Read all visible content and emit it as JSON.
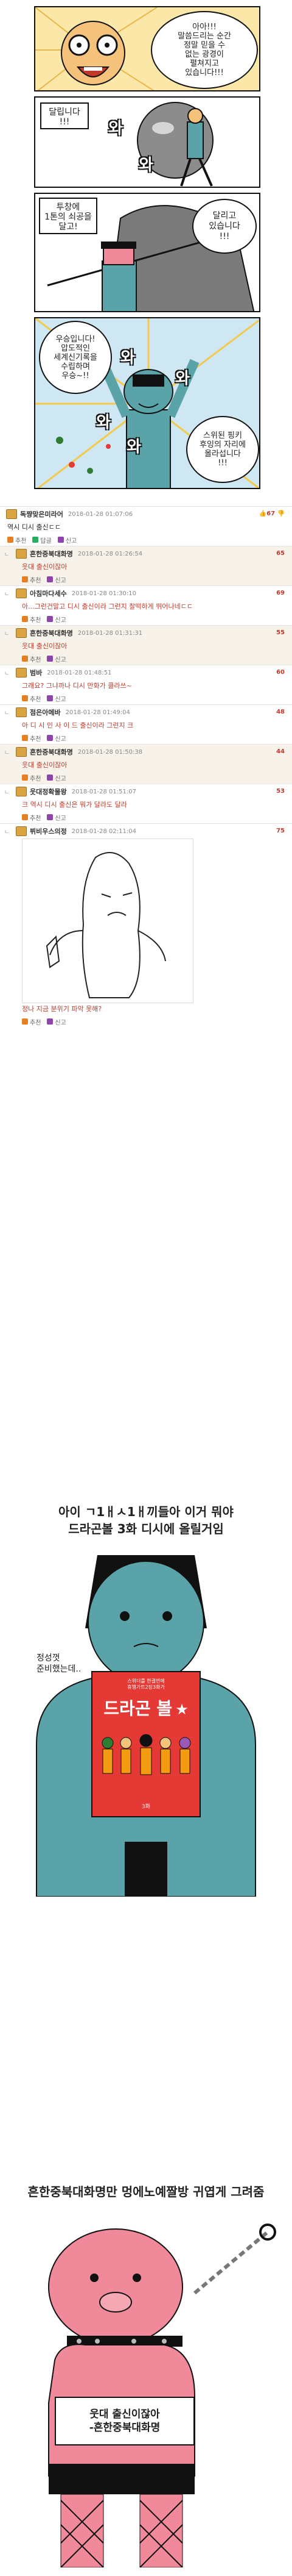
{
  "panels": {
    "p1": {
      "speech": "아아!!!\n말씀드리는 순간\n정말 믿을 수\n없는 광경이\n펼쳐지고\n있습니다!!!"
    },
    "p2": {
      "speech": "달립니다\n!!!",
      "wa_left": "와",
      "wa_right": "와"
    },
    "p3": {
      "caption_left": "투창에\n1톤의 쇠공을\n달고!",
      "caption_right": "달리고\n있습니다\n!!!"
    },
    "p4": {
      "speech_left": "우승입니다!\n압도적인\n세계신기록을\n수립하며\n우승~!!",
      "speech_right": "스위된 핑키\n후잉의 자리에\n올라섭니다\n!!!",
      "wa1": "와",
      "wa2": "와",
      "wa3": "와",
      "wa4": "와"
    }
  },
  "comments": [
    {
      "reply": false,
      "nick": "독쨩맞은미라어",
      "date": "2018-01-28 01:07:06",
      "likes": "67",
      "text": "역시 디시 출신ㄷㄷ",
      "actions": [
        "추천",
        "답글",
        "신고"
      ]
    },
    {
      "reply": true,
      "nick": "흔한중북대화명",
      "date": "2018-01-28 01:26:54",
      "likes": "65",
      "text": "웃대 출신이잖아",
      "actions": [
        "추천",
        "신고"
      ]
    },
    {
      "reply": true,
      "nick": "아침마다세수",
      "date": "2018-01-28 01:30:10",
      "likes": "69",
      "text": "아...그런건말고 디시 출신이라 그런지 찰떡하게 뛰어나네ㄷㄷ",
      "actions": [
        "추천",
        "신고"
      ]
    },
    {
      "reply": true,
      "nick": "흔한중북대화명",
      "date": "2018-01-28 01:31:31",
      "likes": "55",
      "text": "웃대 출신이잖아",
      "actions": [
        "추천",
        "신고"
      ]
    },
    {
      "reply": true,
      "nick": "범바",
      "date": "2018-01-28 01:48:51",
      "likes": "60",
      "text": "그래요? 그냐까나 디시 만화가 클라쓰~",
      "actions": [
        "추천",
        "신고"
      ]
    },
    {
      "reply": true,
      "nick": "점은아메바",
      "date": "2018-01-28 01:49:04",
      "likes": "48",
      "text": "아 디 시 인 사 이 드 출신이라 그런지 크",
      "actions": [
        "추천",
        "신고"
      ]
    },
    {
      "reply": true,
      "nick": "흔한중북대화명",
      "date": "2018-01-28 01:50:38",
      "likes": "44",
      "text": "웃대 출신이잖아",
      "actions": [
        "추천",
        "신고"
      ]
    },
    {
      "reply": true,
      "nick": "웃대정확물왕",
      "date": "2018-01-28 01:51:07",
      "likes": "53",
      "text": "크 역시 디시 출신은 뭐가 달라도 달라",
      "actions": [
        "추천",
        "신고"
      ]
    },
    {
      "reply": true,
      "nick": "뷔비우스의정",
      "date": "2018-01-28 02:11:04",
      "likes": "75",
      "text": "정나 지금 분위기 파악 못해?",
      "actions": [
        "추천",
        "신고"
      ]
    }
  ],
  "bottom": {
    "title1": "아이 ㄱ1ㅐㅅ1ㅐ끼들아 이거 뭐야\n드라곤볼 3화 디시에 올릴거임",
    "speech1": "정성껏\n준비했는데..",
    "book_top": "스위더를 한결변에\n휴행가트2장3화가",
    "book_title": "드라곤 볼",
    "book_star": "★",
    "book_small": "3화",
    "title2": "흔한중북대화명만 멍에노예짤방 귀엽게 그려줌",
    "sign": "웃대 출신이잖아\n-흔한중북대화명"
  },
  "colors": {
    "teal": "#5aa3a8",
    "pink": "#f08a9b",
    "red": "#c0392b",
    "book": "#e53935"
  }
}
